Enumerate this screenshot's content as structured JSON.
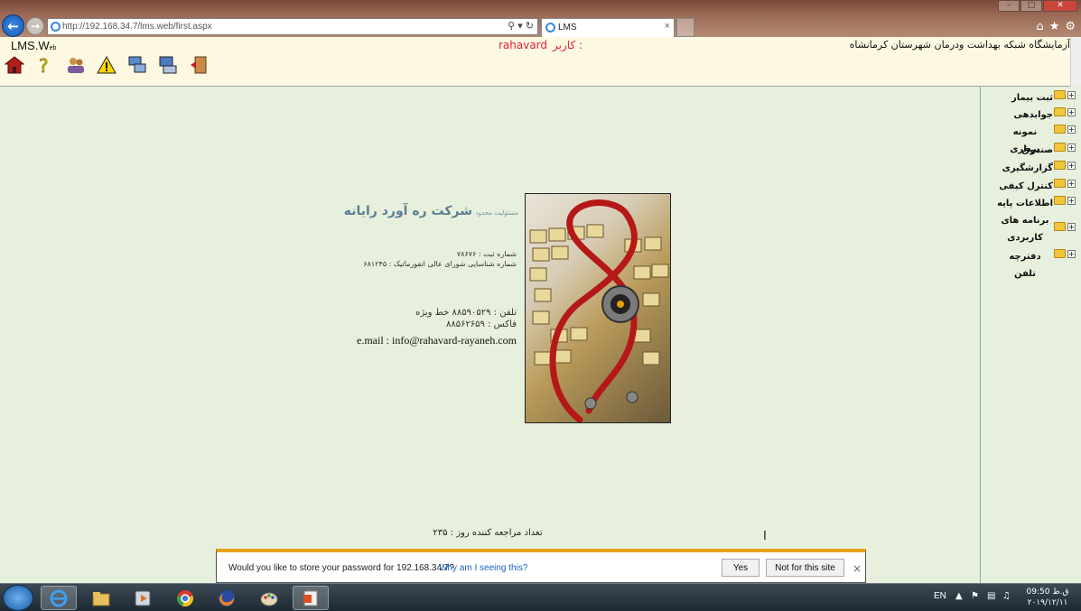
{
  "browser": {
    "address": "http://192.168.34.7/lms.web/first.aspx",
    "tab_title": "LMS",
    "tab_close": "×"
  },
  "header": {
    "logo": "LMS.W",
    "logo_suffix": "eb",
    "user_label": "کاربر :",
    "user_name": "rahavard",
    "org_title": "آزمایشگاه شبکه بهداشت ودرمان شهرستان کرمانشاه"
  },
  "toolbar": [
    "home-icon",
    "help-icon",
    "users-icon",
    "warning-icon",
    "network-icon",
    "computer-icon",
    "exit-icon"
  ],
  "sidebar": {
    "items": [
      {
        "label": "ثبت بیمار"
      },
      {
        "label": "جوابدهی"
      },
      {
        "label": "نمونه برداری"
      },
      {
        "label": "صندوق"
      },
      {
        "label": "گزارشگیری"
      },
      {
        "label": "کنترل کیفی"
      },
      {
        "label": "اطلاعات پایه"
      },
      {
        "label": "برنامه های کاربردی"
      },
      {
        "label": "دفترچه تلفن"
      }
    ]
  },
  "company": {
    "name": "شرکت ره آورد رایانه",
    "subtitle": "مسئولیت محدود",
    "reg_no": "شماره ثبت : ۷۸۶۷۶",
    "reg_id": "شماره شناسایی شورای عالی انفورماتیک : ۶۸۱۲۴۵",
    "phone": "تلفن : ۸۸۵۹۰۵۲۹ خط ویژه",
    "fax": "فاکس : ۸۸۵۶۲۶۵۹",
    "email": "e.mail : info@rahavard-rayaneh.com"
  },
  "visitors": "تعداد مراجعه کننده روز : ۲۳۵",
  "password_bar": {
    "message": "Would you like to store your password for 192.168.34.7?",
    "why": "Why am I seeing this?",
    "yes": "Yes",
    "no": "Not for this site",
    "close": "×"
  },
  "taskbar": {
    "lang": "EN",
    "time": "ق.ظ 09:50",
    "date": "۲۰۱۹/۱۲/۱۱"
  }
}
